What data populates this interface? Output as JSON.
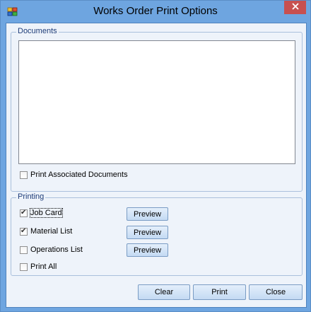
{
  "window": {
    "title": "Works Order Print Options",
    "close_glyph": "×",
    "icon": "app-icon"
  },
  "documents": {
    "legend": "Documents",
    "print_associated_label": "Print Associated Documents",
    "print_associated_checked": false
  },
  "printing": {
    "legend": "Printing",
    "items": [
      {
        "label": "Job Card",
        "checked": true,
        "preview_label": "Preview"
      },
      {
        "label": "Material List",
        "checked": true,
        "preview_label": "Preview"
      },
      {
        "label": "Operations List",
        "checked": false,
        "preview_label": "Preview"
      }
    ],
    "print_all_label": "Print All",
    "print_all_checked": false
  },
  "footer": {
    "clear_label": "Clear",
    "print_label": "Print",
    "close_label": "Close"
  },
  "colors": {
    "title_bar": "#6ea5e0",
    "close_button": "#c75050",
    "client_bg": "#eef3fa",
    "legend_text": "#1d3c78"
  }
}
